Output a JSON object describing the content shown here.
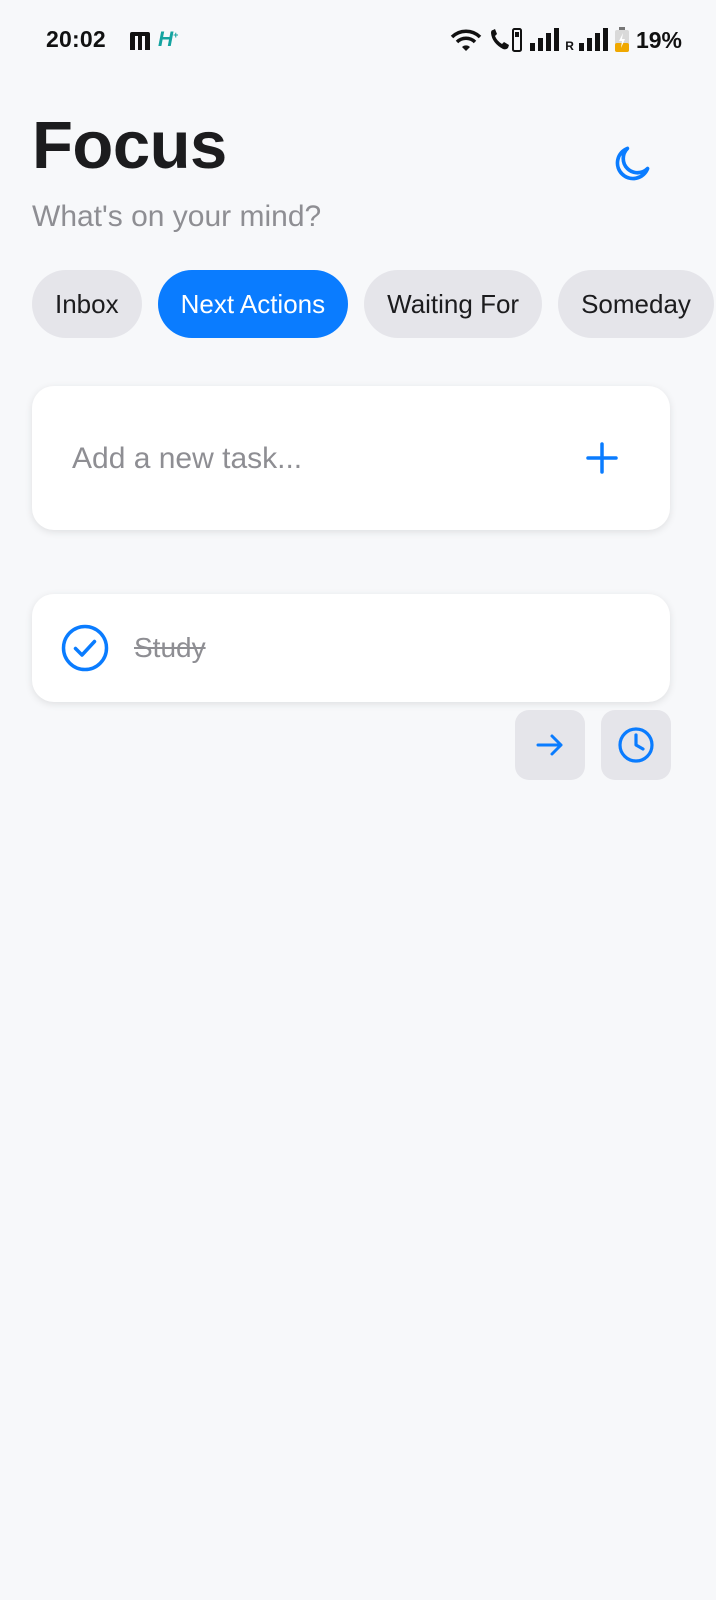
{
  "status_bar": {
    "time": "20:02",
    "carrier_roaming": "R",
    "battery": "19%"
  },
  "header": {
    "title": "Focus",
    "subtitle": "What's on your mind?"
  },
  "tabs": [
    {
      "label": "Inbox",
      "active": false
    },
    {
      "label": "Next Actions",
      "active": true
    },
    {
      "label": "Waiting For",
      "active": false
    },
    {
      "label": "Someday",
      "active": false
    }
  ],
  "add_task": {
    "placeholder": "Add a new task...",
    "value": ""
  },
  "tasks": [
    {
      "label": "Study",
      "completed": true
    }
  ],
  "colors": {
    "accent": "#0a7cff",
    "background": "#f7f8fa",
    "chip": "#e5e5ea",
    "muted_text": "#8e8e93"
  },
  "icons": {
    "theme_toggle": "moon-icon",
    "add": "plus-icon",
    "task_check": "check-circle-icon",
    "move": "arrow-right-icon",
    "snooze": "clock-icon"
  }
}
